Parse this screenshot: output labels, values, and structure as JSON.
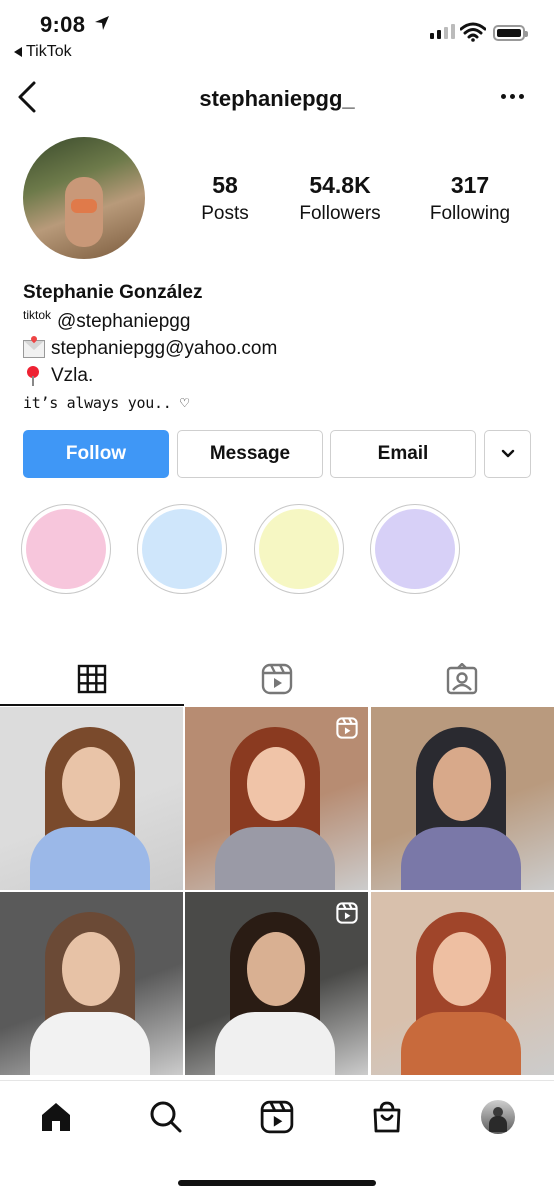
{
  "status_bar": {
    "time": "9:08",
    "back_app": "TikTok"
  },
  "header": {
    "username": "stephaniepgg_"
  },
  "stats": {
    "posts": {
      "value": "58",
      "label": "Posts"
    },
    "followers": {
      "value": "54.8K",
      "label": "Followers"
    },
    "following": {
      "value": "317",
      "label": "Following"
    }
  },
  "bio": {
    "name": "Stephanie González",
    "tiktok_prefix": "tiktok",
    "tiktok_handle": "@stephaniepgg",
    "email": "stephaniepgg@yahoo.com",
    "location": "Vzla.",
    "quote": "it’s always you.. ♡"
  },
  "buttons": {
    "follow": "Follow",
    "message": "Message",
    "email": "Email"
  },
  "highlights": [
    {
      "color": "#f7c6dc"
    },
    {
      "color": "#cfe6fb"
    },
    {
      "color": "#f6f7c3"
    },
    {
      "color": "#d7d0f7"
    }
  ],
  "tabs": [
    {
      "icon": "grid-icon",
      "active": true
    },
    {
      "icon": "reels-icon",
      "active": false
    },
    {
      "icon": "tagged-icon",
      "active": false
    }
  ],
  "grid": [
    {
      "bg": "#dcdcdc",
      "accent": "#9bb8e8",
      "skin": "#e9c4a8",
      "hair": "#7a4a2c",
      "reel": false
    },
    {
      "bg": "#b78c72",
      "accent": "#9a9aa6",
      "skin": "#f0c4a8",
      "hair": "#8a3a20",
      "reel": true
    },
    {
      "bg": "#b99a7e",
      "accent": "#7a78a8",
      "skin": "#d8a98a",
      "hair": "#2a2a30",
      "reel": false
    },
    {
      "bg": "#5a5a5a",
      "accent": "#f2f2f2",
      "skin": "#e7c2a6",
      "hair": "#6b4a36",
      "reel": false
    },
    {
      "bg": "#4a4a48",
      "accent": "#f0f0f0",
      "skin": "#d9b092",
      "hair": "#2a1c14",
      "reel": true
    },
    {
      "bg": "#d8c0ac",
      "accent": "#c86a3c",
      "skin": "#eebfa2",
      "hair": "#a0452a",
      "reel": false
    }
  ],
  "bottom_nav": [
    "home-icon",
    "search-icon",
    "reels-icon",
    "shop-icon",
    "profile-avatar"
  ],
  "colors": {
    "follow_blue": "#3f97f6",
    "border": "#cfcfcf"
  }
}
